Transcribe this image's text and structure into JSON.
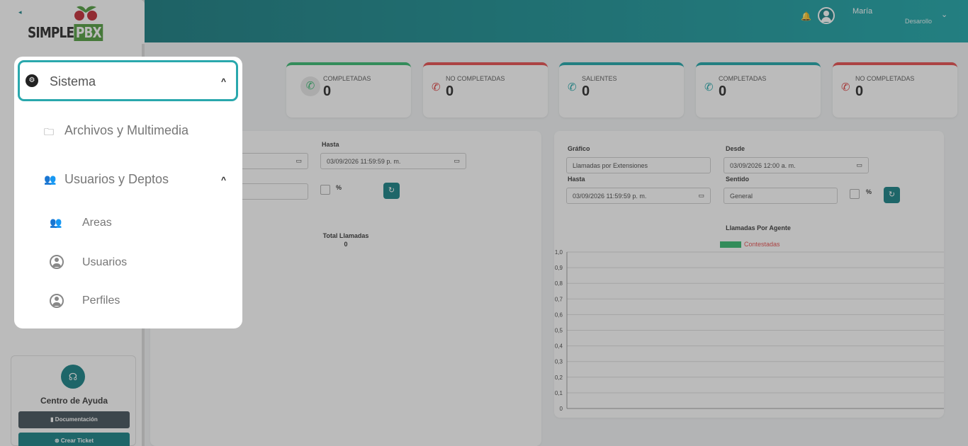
{
  "header": {
    "user_name": "María",
    "user_role": "Desarollo"
  },
  "sidebar": {
    "logo_text_1": "SIMPLE",
    "logo_text_2": "PBX",
    "help": {
      "title": "Centro de Ayuda",
      "doc_label": "Documentación",
      "ticket_label": "Crear Ticket"
    }
  },
  "stats": [
    {
      "label": "COMPLETADAS",
      "value": "0"
    },
    {
      "label": "NO COMPLETADAS",
      "value": "0"
    },
    {
      "label": "SALIENTES",
      "value": "0"
    },
    {
      "label": "COMPLETADAS",
      "value": "0"
    },
    {
      "label": "NO COMPLETADAS",
      "value": "0"
    }
  ],
  "left_panel": {
    "hasta_label": "Hasta",
    "hasta_value": "03/09/2026 11:59:59 p. m.",
    "pct_label": "%",
    "total_label": "Total Llamadas",
    "total_value": "0"
  },
  "right_panel": {
    "grafico_label": "Gráfico",
    "grafico_value": "Llamadas por Extensiones",
    "desde_label": "Desde",
    "desde_value": "03/09/2026 12:00 a. m.",
    "hasta_label": "Hasta",
    "hasta_value": "03/09/2026 11:59:59 p. m.",
    "sentido_label": "Sentido",
    "sentido_value": "General",
    "pct_label": "%"
  },
  "chart_data": {
    "type": "bar",
    "title": "Llamadas Por Agente",
    "categories": [],
    "series": [
      {
        "name": "Contestadas",
        "values": []
      }
    ],
    "ylim": [
      0,
      1
    ],
    "yticks": [
      "0",
      "0,1",
      "0,2",
      "0,3",
      "0,4",
      "0,5",
      "0,6",
      "0,7",
      "0,8",
      "0,9",
      "1,0"
    ],
    "grid": true,
    "legend": "top",
    "colors": {
      "Contestadas": "#2fb76b"
    }
  },
  "menu": {
    "sistema_label": "Sistema",
    "items": [
      {
        "label": "Archivos y Multimedia"
      },
      {
        "label": "Usuarios y Deptos"
      }
    ],
    "subitems": [
      {
        "label": "Areas"
      },
      {
        "label": "Usuarios"
      },
      {
        "label": "Perfiles"
      }
    ]
  }
}
